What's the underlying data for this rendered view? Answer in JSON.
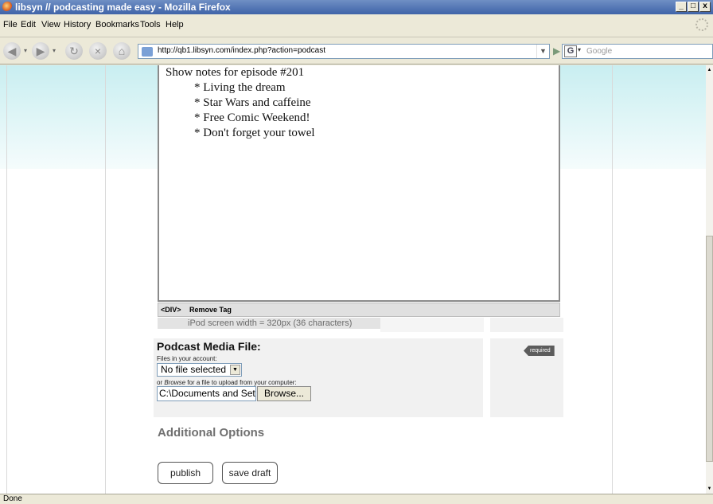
{
  "window": {
    "title": "libsyn // podcasting made easy - Mozilla Firefox",
    "min": "_",
    "max": "□",
    "close": "x"
  },
  "menu": [
    "File",
    "Edit",
    "View",
    "History",
    "Bookmarks",
    "Tools",
    "Help"
  ],
  "nav": {
    "url": "http://qb1.libsyn.com/index.php?action=podcast",
    "search_placeholder": "Google",
    "search_engine_letter": "G"
  },
  "editor": {
    "heading": "Show notes for episode #201",
    "items": [
      "* Living the dream",
      "* Star Wars and caffeine",
      "* Free Comic Weekend!",
      "* Don't forget your towel"
    ],
    "status_tag": "<DIV>",
    "status_action": "Remove Tag",
    "ipod_note": "iPod screen width = 320px (36 characters)"
  },
  "media": {
    "title": "Podcast Media File:",
    "files_label": "Files in your account:",
    "select_value": "No file selected",
    "browse_hint_prefix": "or ",
    "browse_hint_em": "Browse",
    "browse_hint_suffix": " for a file to upload from your computer:",
    "file_path": "C:\\Documents and Setti",
    "browse_button": "Browse...",
    "required_tag": "required"
  },
  "additional_options": "Additional Options",
  "buttons": {
    "publish": "publish",
    "save_draft": "save draft"
  },
  "statusbar": "Done",
  "colors": {
    "accent_teal": "#3cc3cc",
    "titlebar": "#3f63a8"
  }
}
